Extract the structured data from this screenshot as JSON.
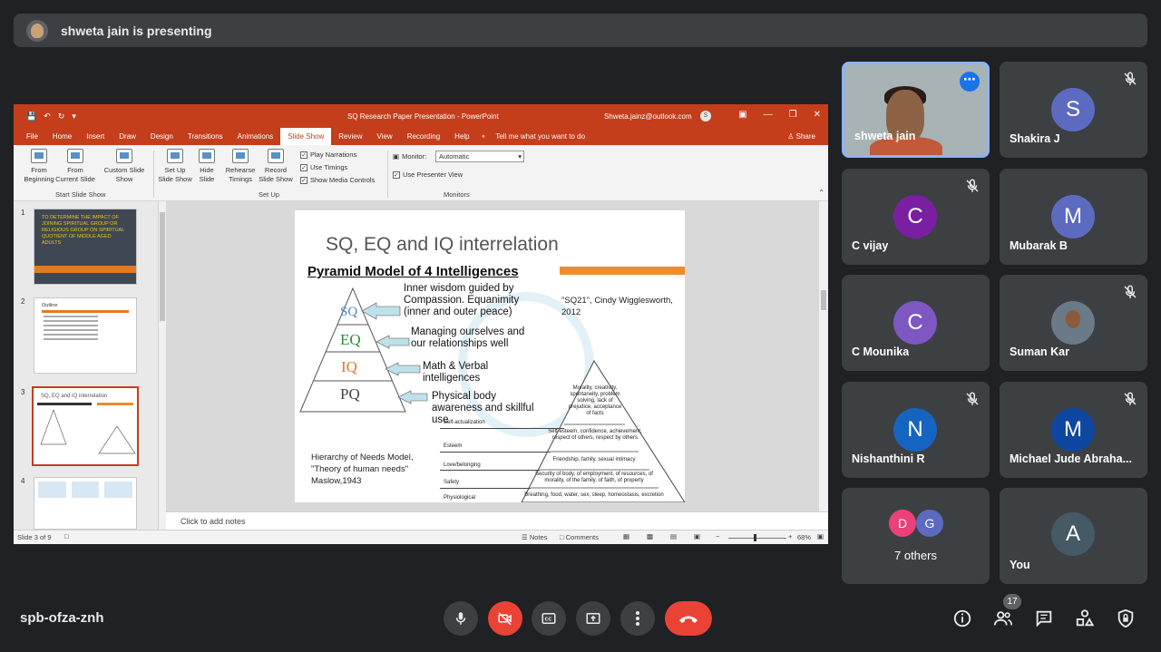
{
  "presenter_bar": {
    "text": "shweta jain is presenting"
  },
  "powerpoint": {
    "window_title": "SQ Research Paper Presentation - PowerPoint",
    "account": "Shweta.jainz@outlook.com",
    "account_initial": "S",
    "tabs": [
      "File",
      "Home",
      "Insert",
      "Draw",
      "Design",
      "Transitions",
      "Animations",
      "Slide Show",
      "Review",
      "View",
      "Recording",
      "Help"
    ],
    "tell_me": "Tell me what you want to do",
    "share": "Share",
    "ribbon": {
      "from_beginning": "From Beginning",
      "from_current": "From Current Slide",
      "custom_show": "Custom Slide Show",
      "group_start": "Start Slide Show",
      "setup_show": "Set Up Slide Show",
      "hide_slide": "Hide Slide",
      "rehearse": "Rehearse Timings",
      "record": "Record Slide Show",
      "group_setup": "Set Up",
      "play_narrations": "Play Narrations",
      "use_timings": "Use Timings",
      "show_media": "Show Media Controls",
      "monitor_label": "Monitor:",
      "monitor_value": "Automatic",
      "presenter_view": "Use Presenter View",
      "group_monitors": "Monitors"
    },
    "thumbnails": {
      "n1": "1",
      "n2": "2",
      "n3": "3",
      "n4": "4",
      "t1_text": "TO DETERMINE THE IMPACT OF JOINING SPIRITUAL GROUP OR RELIGIOUS GROUP ON SPIRITUAL QUOTIENT OF MIDDLE AGED ADULTS",
      "t2_title": "Outline",
      "t3_title": "SQ, EQ and IQ interrelation"
    },
    "slide": {
      "title": "SQ, EQ and IQ interrelation",
      "subtitle": "Pyramid Model of 4 Intelligences",
      "levels": [
        "SQ",
        "EQ",
        "IQ",
        "PQ"
      ],
      "level_colors": [
        "#4a86c5",
        "#2e8b3a",
        "#e07b24",
        "#444444"
      ],
      "desc_sq": "Inner wisdom guided by Compassion. Equanimity (inner and outer peace)",
      "desc_eq": "Managing ourselves and our relationships well",
      "desc_iq": "Math & Verbal intelligences",
      "desc_pq": "Physical body awareness and skillful use",
      "cite1": "\"SQ21\", Cindy Wigglesworth, 2012",
      "cite2": "Hierarchy of Needs Model, \"Theory of human needs\" Maslow,1943",
      "maslow": {
        "top": "Morality, creativity, spontaneity, problem solving, lack of prejudice, acceptance of facts",
        "esteem": "Self-esteem, confidence, achievement, respect of others, respect by others",
        "love": "Friendship, family, sexual intimacy",
        "safety": "Security of body, of employment, of resources, of morality, of the family, of faith, of property",
        "phys": "Breathing, food, water, sex, sleep, homeostasis, excretion",
        "labels": [
          "Self-actualization",
          "Esteem",
          "Love/belonging",
          "Safety",
          "Physiological"
        ]
      }
    },
    "notes_placeholder": "Click to add notes",
    "status": {
      "slide_count": "Slide 3 of 9",
      "notes": "Notes",
      "comments": "Comments",
      "zoom": "68%"
    }
  },
  "participants": [
    {
      "name": "shweta jain",
      "type": "video"
    },
    {
      "name": "Shakira J",
      "initial": "S",
      "color": "#5c6bc0",
      "muted": true
    },
    {
      "name": "C vijay",
      "initial": "C",
      "color": "#7b1fa2",
      "muted": true
    },
    {
      "name": "Mubarak B",
      "initial": "M",
      "color": "#5c6bc0",
      "muted": false
    },
    {
      "name": "C Mounika",
      "initial": "C",
      "color": "#7e57c2",
      "muted": false
    },
    {
      "name": "Suman Kar",
      "type": "photo",
      "muted": true
    },
    {
      "name": "Nishanthini R",
      "initial": "N",
      "color": "#1565c0",
      "muted": true
    },
    {
      "name": "Michael Jude Abraha...",
      "initial": "M",
      "color": "#0d47a1",
      "muted": true
    },
    {
      "name": "You",
      "initial": "A",
      "color": "#455a64"
    }
  ],
  "others": {
    "label": "7 others",
    "a": "D",
    "b": "G",
    "a_color": "#ec407a",
    "b_color": "#5c6bc0"
  },
  "bottom_bar": {
    "meeting_code": "spb-ofza-znh",
    "people_count": "17"
  }
}
